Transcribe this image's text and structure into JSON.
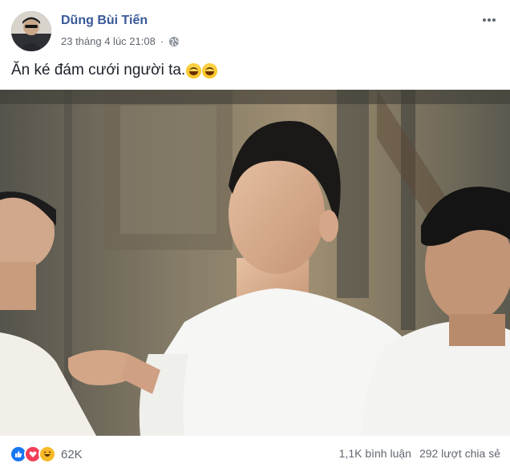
{
  "post": {
    "author": "Dũng Bùi Tiến",
    "timestamp": "23 tháng 4 lúc 21:08",
    "privacy_icon": "globe-icon",
    "more_icon": "more-options-icon",
    "caption": "Ăn ké đám cưới người ta.",
    "caption_emojis": [
      "grinning-face",
      "grinning-face"
    ]
  },
  "reactions": {
    "types": [
      "like",
      "love",
      "haha"
    ],
    "count": "62K"
  },
  "stats": {
    "comments": "1,1K bình luận",
    "shares": "292 lượt chia sẻ"
  },
  "colors": {
    "author_link": "#385898",
    "meta_text": "#616770",
    "like": "#1877f2",
    "love": "#f33e58",
    "haha": "#f7b928"
  }
}
